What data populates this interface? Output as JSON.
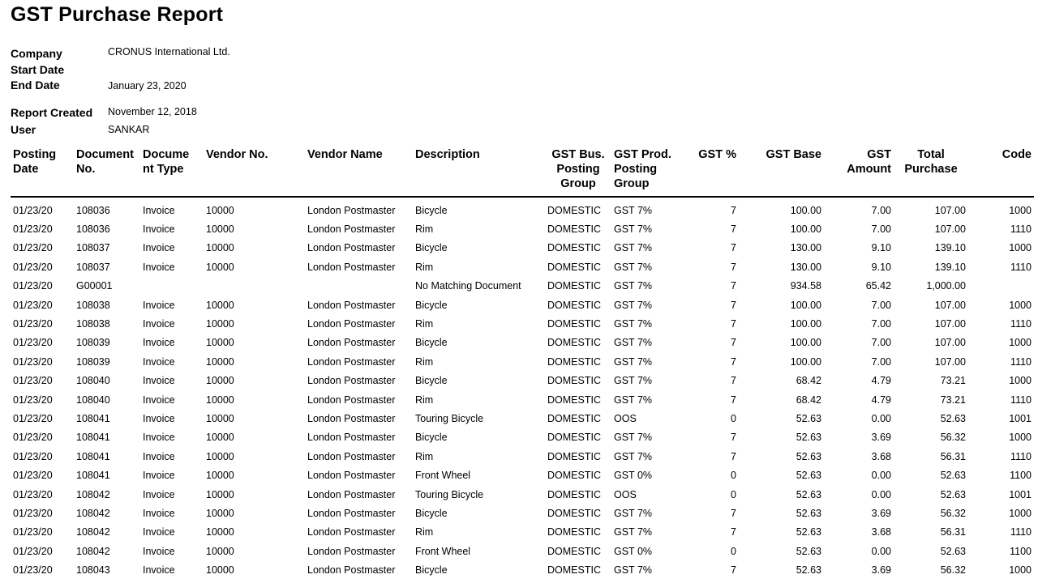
{
  "report": {
    "title": "GST Purchase Report",
    "company_label": "Company",
    "company_value": "CRONUS International Ltd.",
    "start_date_label": "Start Date",
    "start_date_value": "",
    "end_date_label": "End Date",
    "end_date_value": "January 23, 2020",
    "created_label": "Report Created",
    "created_value": "November 12, 2018",
    "user_label": "User",
    "user_value": "SANKAR"
  },
  "table": {
    "headers": [
      "Posting Date",
      "Document No.",
      "Docume nt Type",
      "Vendor No.",
      "Vendor Name",
      "Description",
      "GST Bus. Posting Group",
      "GST Prod. Posting Group",
      "GST %",
      "GST Base",
      "GST Amount",
      "Total Purchase",
      "Code"
    ],
    "rows": [
      [
        "01/23/20",
        "108036",
        "Invoice",
        "10000",
        "London Postmaster",
        "Bicycle",
        "DOMESTIC",
        "GST 7%",
        "7",
        "100.00",
        "7.00",
        "107.00",
        "1000"
      ],
      [
        "01/23/20",
        "108036",
        "Invoice",
        "10000",
        "London Postmaster",
        "Rim",
        "DOMESTIC",
        "GST 7%",
        "7",
        "100.00",
        "7.00",
        "107.00",
        "1110"
      ],
      [
        "01/23/20",
        "108037",
        "Invoice",
        "10000",
        "London Postmaster",
        "Bicycle",
        "DOMESTIC",
        "GST 7%",
        "7",
        "130.00",
        "9.10",
        "139.10",
        "1000"
      ],
      [
        "01/23/20",
        "108037",
        "Invoice",
        "10000",
        "London Postmaster",
        "Rim",
        "DOMESTIC",
        "GST 7%",
        "7",
        "130.00",
        "9.10",
        "139.10",
        "1110"
      ],
      [
        "01/23/20",
        "G00001",
        "",
        "",
        "",
        "No Matching Document",
        "DOMESTIC",
        "GST 7%",
        "7",
        "934.58",
        "65.42",
        "1,000.00",
        ""
      ],
      [
        "01/23/20",
        "108038",
        "Invoice",
        "10000",
        "London Postmaster",
        "Bicycle",
        "DOMESTIC",
        "GST 7%",
        "7",
        "100.00",
        "7.00",
        "107.00",
        "1000"
      ],
      [
        "01/23/20",
        "108038",
        "Invoice",
        "10000",
        "London Postmaster",
        "Rim",
        "DOMESTIC",
        "GST 7%",
        "7",
        "100.00",
        "7.00",
        "107.00",
        "1110"
      ],
      [
        "01/23/20",
        "108039",
        "Invoice",
        "10000",
        "London Postmaster",
        "Bicycle",
        "DOMESTIC",
        "GST 7%",
        "7",
        "100.00",
        "7.00",
        "107.00",
        "1000"
      ],
      [
        "01/23/20",
        "108039",
        "Invoice",
        "10000",
        "London Postmaster",
        "Rim",
        "DOMESTIC",
        "GST 7%",
        "7",
        "100.00",
        "7.00",
        "107.00",
        "1110"
      ],
      [
        "01/23/20",
        "108040",
        "Invoice",
        "10000",
        "London Postmaster",
        "Bicycle",
        "DOMESTIC",
        "GST 7%",
        "7",
        "68.42",
        "4.79",
        "73.21",
        "1000"
      ],
      [
        "01/23/20",
        "108040",
        "Invoice",
        "10000",
        "London Postmaster",
        "Rim",
        "DOMESTIC",
        "GST 7%",
        "7",
        "68.42",
        "4.79",
        "73.21",
        "1110"
      ],
      [
        "01/23/20",
        "108041",
        "Invoice",
        "10000",
        "London Postmaster",
        "Touring Bicycle",
        "DOMESTIC",
        "OOS",
        "0",
        "52.63",
        "0.00",
        "52.63",
        "1001"
      ],
      [
        "01/23/20",
        "108041",
        "Invoice",
        "10000",
        "London Postmaster",
        "Bicycle",
        "DOMESTIC",
        "GST 7%",
        "7",
        "52.63",
        "3.69",
        "56.32",
        "1000"
      ],
      [
        "01/23/20",
        "108041",
        "Invoice",
        "10000",
        "London Postmaster",
        "Rim",
        "DOMESTIC",
        "GST 7%",
        "7",
        "52.63",
        "3.68",
        "56.31",
        "1110"
      ],
      [
        "01/23/20",
        "108041",
        "Invoice",
        "10000",
        "London Postmaster",
        "Front Wheel",
        "DOMESTIC",
        "GST 0%",
        "0",
        "52.63",
        "0.00",
        "52.63",
        "1100"
      ],
      [
        "01/23/20",
        "108042",
        "Invoice",
        "10000",
        "London Postmaster",
        "Touring Bicycle",
        "DOMESTIC",
        "OOS",
        "0",
        "52.63",
        "0.00",
        "52.63",
        "1001"
      ],
      [
        "01/23/20",
        "108042",
        "Invoice",
        "10000",
        "London Postmaster",
        "Bicycle",
        "DOMESTIC",
        "GST 7%",
        "7",
        "52.63",
        "3.69",
        "56.32",
        "1000"
      ],
      [
        "01/23/20",
        "108042",
        "Invoice",
        "10000",
        "London Postmaster",
        "Rim",
        "DOMESTIC",
        "GST 7%",
        "7",
        "52.63",
        "3.68",
        "56.31",
        "1110"
      ],
      [
        "01/23/20",
        "108042",
        "Invoice",
        "10000",
        "London Postmaster",
        "Front Wheel",
        "DOMESTIC",
        "GST 0%",
        "0",
        "52.63",
        "0.00",
        "52.63",
        "1100"
      ],
      [
        "01/23/20",
        "108043",
        "Invoice",
        "10000",
        "London Postmaster",
        "Bicycle",
        "DOMESTIC",
        "GST 7%",
        "7",
        "52.63",
        "3.69",
        "56.32",
        "1000"
      ]
    ]
  }
}
